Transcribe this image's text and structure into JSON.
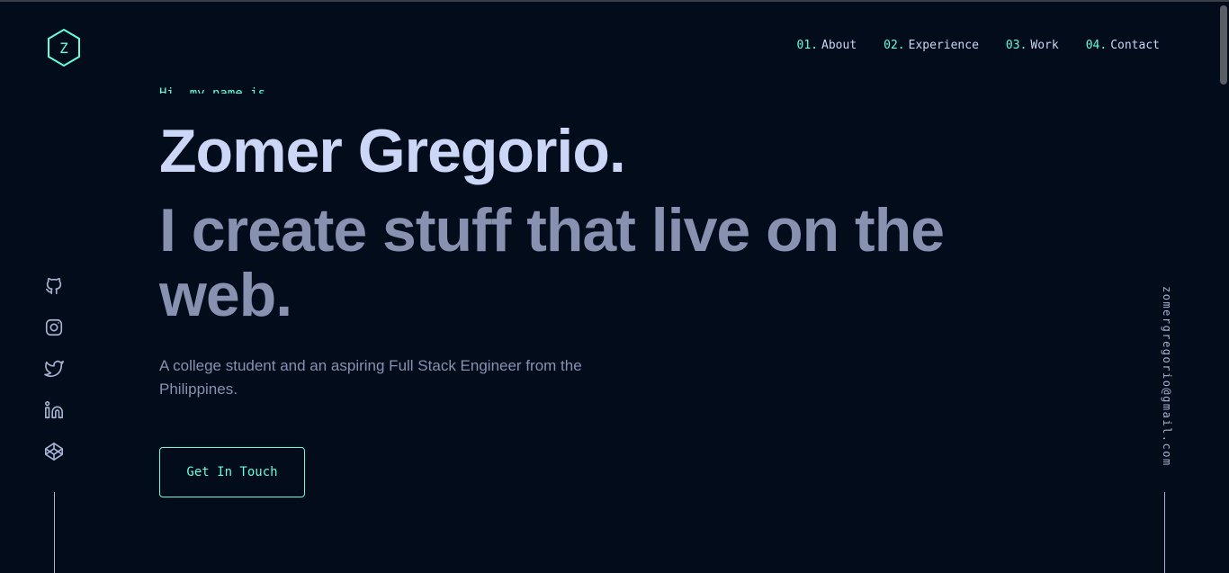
{
  "logo": {
    "letter": "Z"
  },
  "nav": {
    "items": [
      {
        "num": "01.",
        "label": "About"
      },
      {
        "num": "02.",
        "label": "Experience"
      },
      {
        "num": "03.",
        "label": "Work"
      },
      {
        "num": "04.",
        "label": "Contact"
      }
    ]
  },
  "hero": {
    "greeting": "Hi, my name is",
    "name": "Zomer Gregorio.",
    "tagline": "I create stuff that live on the web.",
    "description": "A college student and an aspiring Full Stack Engineer from the Philippines.",
    "cta_label": "Get In Touch"
  },
  "social": {
    "icons": [
      "github-icon",
      "instagram-icon",
      "twitter-icon",
      "linkedin-icon",
      "codepen-icon"
    ]
  },
  "email": "zomergregorio@gmail.com",
  "colors": {
    "background": "#020c1b",
    "accent": "#64ffda",
    "heading": "#ccd6f6",
    "muted": "#8892b0"
  }
}
